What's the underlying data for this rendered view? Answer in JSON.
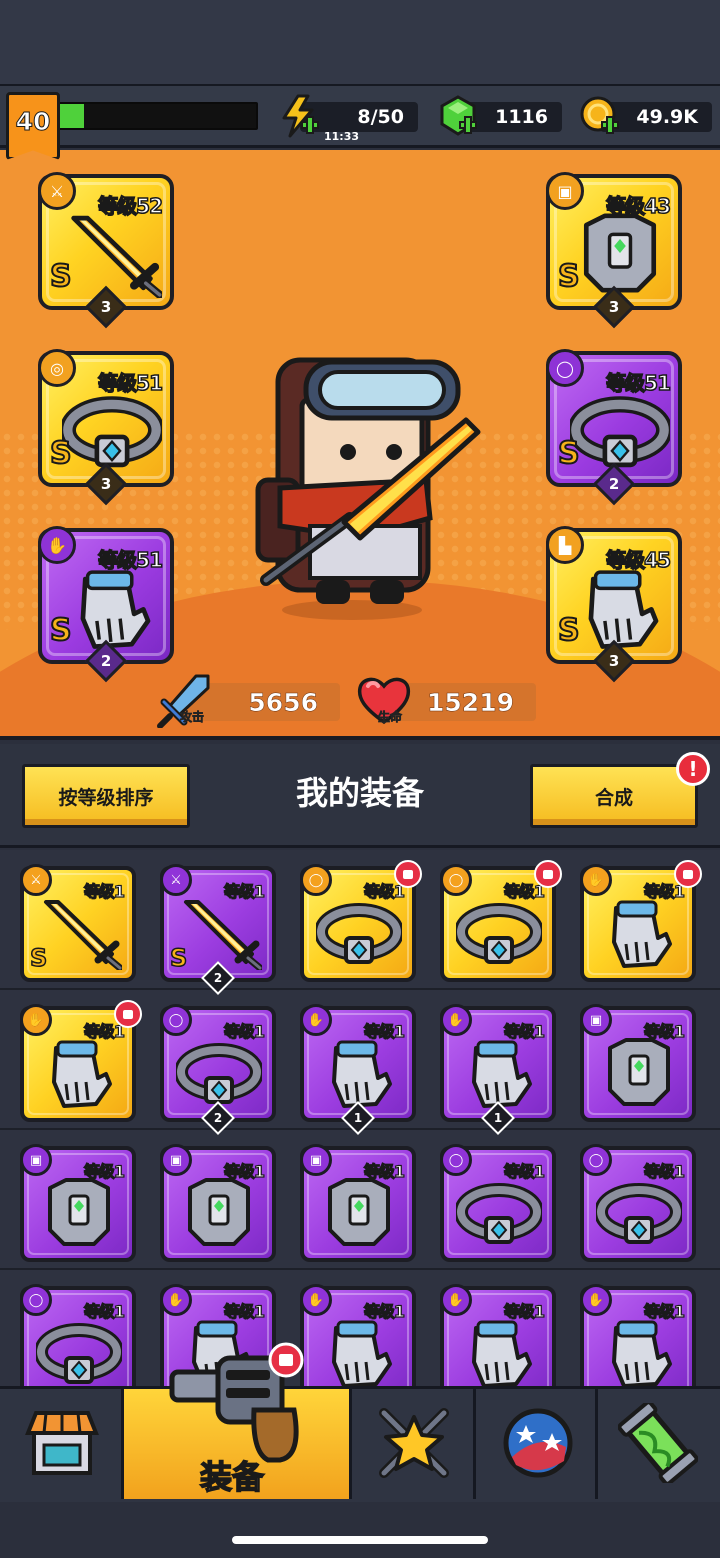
{
  "header": {
    "level": "40",
    "xp_progress": 0.12,
    "energy": "8/50",
    "energy_timer": "11:33",
    "gems": "1116",
    "coins": "49.9K"
  },
  "slots": [
    {
      "level_text": "等级52",
      "grade": "S",
      "stars": "3",
      "rarity": "gold",
      "category_icon": "weapon-icon"
    },
    {
      "level_text": "等级43",
      "grade": "S",
      "stars": "3",
      "rarity": "gold",
      "category_icon": "armor-icon"
    },
    {
      "level_text": "等级51",
      "grade": "S",
      "stars": "3",
      "rarity": "gold",
      "category_icon": "necklace-icon"
    },
    {
      "level_text": "等级51",
      "grade": "S",
      "stars": "2",
      "rarity": "purple",
      "category_icon": "belt-icon"
    },
    {
      "level_text": "等级51",
      "grade": "S",
      "stars": "2",
      "rarity": "purple",
      "category_icon": "glove-icon"
    },
    {
      "level_text": "等级45",
      "grade": "S",
      "stars": "3",
      "rarity": "gold",
      "category_icon": "boots-icon"
    }
  ],
  "stats": {
    "attack_label": "攻击",
    "attack_value": "5656",
    "hp_label": "生命",
    "hp_value": "15219"
  },
  "actions": {
    "sort_label": "按等级排序",
    "title": "我的装备",
    "merge_label": "合成",
    "merge_alert": "!"
  },
  "inventory": [
    {
      "level_text": "等级1",
      "rarity": "gold",
      "grade": "S",
      "stars": "",
      "item": "sword",
      "new": false
    },
    {
      "level_text": "等级1",
      "rarity": "purple",
      "grade": "S",
      "stars": "2",
      "item": "sword",
      "new": false
    },
    {
      "level_text": "等级1",
      "rarity": "gold",
      "grade": "",
      "stars": "",
      "item": "belt",
      "new": true
    },
    {
      "level_text": "等级1",
      "rarity": "gold",
      "grade": "",
      "stars": "",
      "item": "belt",
      "new": true
    },
    {
      "level_text": "等级1",
      "rarity": "gold",
      "grade": "",
      "stars": "",
      "item": "glove",
      "new": true
    },
    {
      "level_text": "等级1",
      "rarity": "gold",
      "grade": "",
      "stars": "",
      "item": "glove",
      "new": true
    },
    {
      "level_text": "等级1",
      "rarity": "purple",
      "grade": "",
      "stars": "2",
      "item": "belt",
      "new": false
    },
    {
      "level_text": "等级1",
      "rarity": "purple",
      "grade": "",
      "stars": "1",
      "item": "glove",
      "new": false
    },
    {
      "level_text": "等级1",
      "rarity": "purple",
      "grade": "",
      "stars": "1",
      "item": "glove",
      "new": false
    },
    {
      "level_text": "等级1",
      "rarity": "purple",
      "grade": "",
      "stars": "",
      "item": "armor",
      "new": false
    },
    {
      "level_text": "等级1",
      "rarity": "purple",
      "grade": "",
      "stars": "",
      "item": "armor",
      "new": false
    },
    {
      "level_text": "等级1",
      "rarity": "purple",
      "grade": "",
      "stars": "",
      "item": "armor",
      "new": false
    },
    {
      "level_text": "等级1",
      "rarity": "purple",
      "grade": "",
      "stars": "",
      "item": "armor",
      "new": false
    },
    {
      "level_text": "等级1",
      "rarity": "purple",
      "grade": "",
      "stars": "",
      "item": "belt",
      "new": false
    },
    {
      "level_text": "等级1",
      "rarity": "purple",
      "grade": "",
      "stars": "",
      "item": "belt",
      "new": false
    },
    {
      "level_text": "等级1",
      "rarity": "purple",
      "grade": "",
      "stars": "",
      "item": "belt",
      "new": false
    },
    {
      "level_text": "等级1",
      "rarity": "purple",
      "grade": "",
      "stars": "",
      "item": "glove",
      "new": false
    },
    {
      "level_text": "等级1",
      "rarity": "purple",
      "grade": "",
      "stars": "",
      "item": "glove",
      "new": false
    },
    {
      "level_text": "等级1",
      "rarity": "purple",
      "grade": "",
      "stars": "",
      "item": "glove",
      "new": false
    },
    {
      "level_text": "等级1",
      "rarity": "purple",
      "grade": "",
      "stars": "",
      "item": "glove",
      "new": false
    }
  ],
  "nav": {
    "tabs": [
      "shop-icon",
      "equipment-icon",
      "skills-icon",
      "planet-icon",
      "dna-icon"
    ],
    "active_label": "装备"
  },
  "colors": {
    "stage_bg": "#f29433",
    "gold": "#ffd223",
    "purple": "#9c3de0",
    "energy": "#f6c11a",
    "gem": "#4fd13b",
    "alert": "#e82d3c"
  }
}
